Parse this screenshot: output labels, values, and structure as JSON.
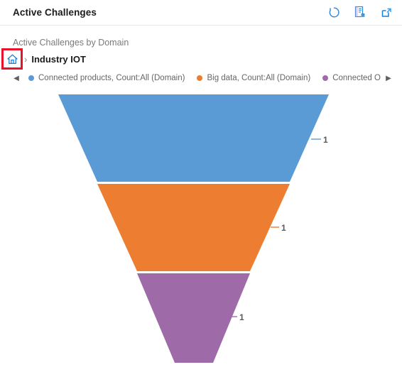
{
  "header": {
    "title": "Active Challenges",
    "actions": [
      {
        "name": "refresh-icon",
        "label": "Refresh"
      },
      {
        "name": "export-to-excel-icon",
        "label": "Export to Excel"
      },
      {
        "name": "pop-out-icon",
        "label": "Expand"
      }
    ]
  },
  "chart_panel": {
    "subtitle": "Active Challenges by Domain",
    "breadcrumb": {
      "home_icon": "home-icon",
      "separator": "›",
      "current": "Industry IOT"
    },
    "legend": {
      "prev_arrow": "◀",
      "next_arrow": "▶",
      "items": [
        {
          "label": "Connected products, Count:All (Domain)",
          "color": "#5b9bd5"
        },
        {
          "label": "Big data, Count:All (Domain)",
          "color": "#ed7d31"
        },
        {
          "label": "Connected Opera",
          "color": "#9e6ba8"
        }
      ]
    }
  },
  "chart_data": {
    "type": "funnel",
    "title": "Active Challenges by Domain",
    "categories": [
      "Connected products, Count:All (Domain)",
      "Big data, Count:All (Domain)",
      "Connected Opera"
    ],
    "values": [
      1,
      1,
      1
    ],
    "data_labels": [
      "1",
      "1",
      "1"
    ],
    "colors": [
      "#5b9bd5",
      "#ed7d31",
      "#9e6ba8"
    ],
    "legend_position": "top",
    "grid": false,
    "xlabel": "",
    "ylabel": ""
  },
  "annotation": {
    "highlight_target": "home-icon",
    "color": "#e8122a"
  }
}
